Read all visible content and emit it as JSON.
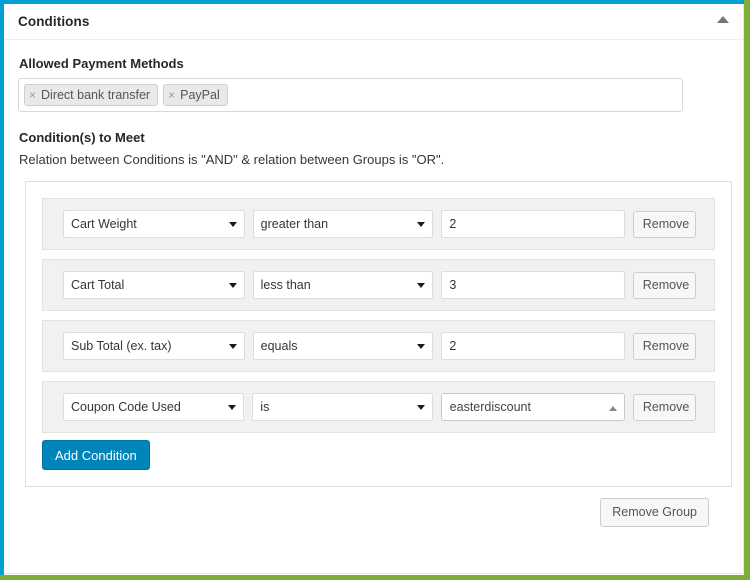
{
  "panel": {
    "title": "Conditions",
    "toggle_icon": "chevron-up-icon",
    "accent_color": "#00a0d2",
    "primary_color": "#0085ba",
    "row_background": "#f1f1f1"
  },
  "payment_methods": {
    "label": "Allowed Payment Methods",
    "chips": [
      {
        "remove_glyph": "×",
        "label": "Direct bank transfer"
      },
      {
        "remove_glyph": "×",
        "label": "PayPal"
      }
    ]
  },
  "conditions_section": {
    "label": "Condition(s) to Meet",
    "note": "Relation between Conditions is \"AND\" & relation between Groups is \"OR\".",
    "rows": [
      {
        "field": "Cart Weight",
        "operator": "greater than",
        "value": "2",
        "value_type": "input",
        "remove_label": "Remove"
      },
      {
        "field": "Cart Total",
        "operator": "less than",
        "value": "3",
        "value_type": "input",
        "remove_label": "Remove"
      },
      {
        "field": "Sub Total (ex. tax)",
        "operator": "equals",
        "value": "2",
        "value_type": "input",
        "remove_label": "Remove"
      },
      {
        "field": "Coupon Code Used",
        "operator": "is",
        "value": "easterdiscount",
        "value_type": "select2",
        "remove_label": "Remove"
      }
    ],
    "add_condition_label": "Add Condition",
    "remove_group_label": "Remove Group"
  }
}
